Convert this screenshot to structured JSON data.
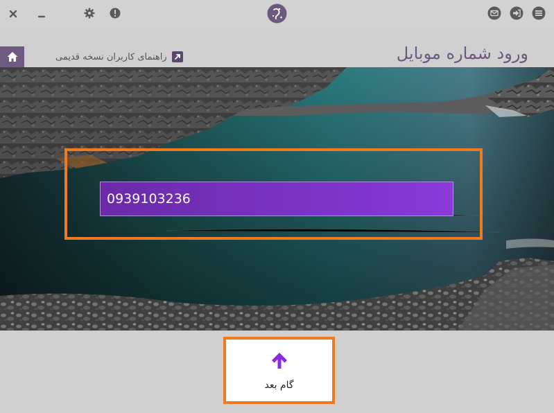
{
  "titlebar": {
    "close_icon": "close-icon",
    "minimize_icon": "minimize-icon",
    "settings_icon": "gear-icon",
    "info_icon": "info-icon",
    "logo_icon": "app-logo-icon",
    "mail_icon": "mail-icon",
    "login_icon": "login-icon",
    "menu_icon": "menu-icon"
  },
  "header": {
    "title": "ورود شماره موبایل",
    "guide_link_label": "راهنمای کاربران نسخه قدیمی",
    "home_icon": "home-icon"
  },
  "form": {
    "phone_value": "0939103236"
  },
  "next": {
    "label": "گام بعد",
    "icon": "arrow-up-icon"
  },
  "colors": {
    "accent_purple": "#7a34c6",
    "highlight_orange": "#f07a22",
    "title_purple": "#6c5a7e",
    "home_bg": "#6f5a82"
  }
}
